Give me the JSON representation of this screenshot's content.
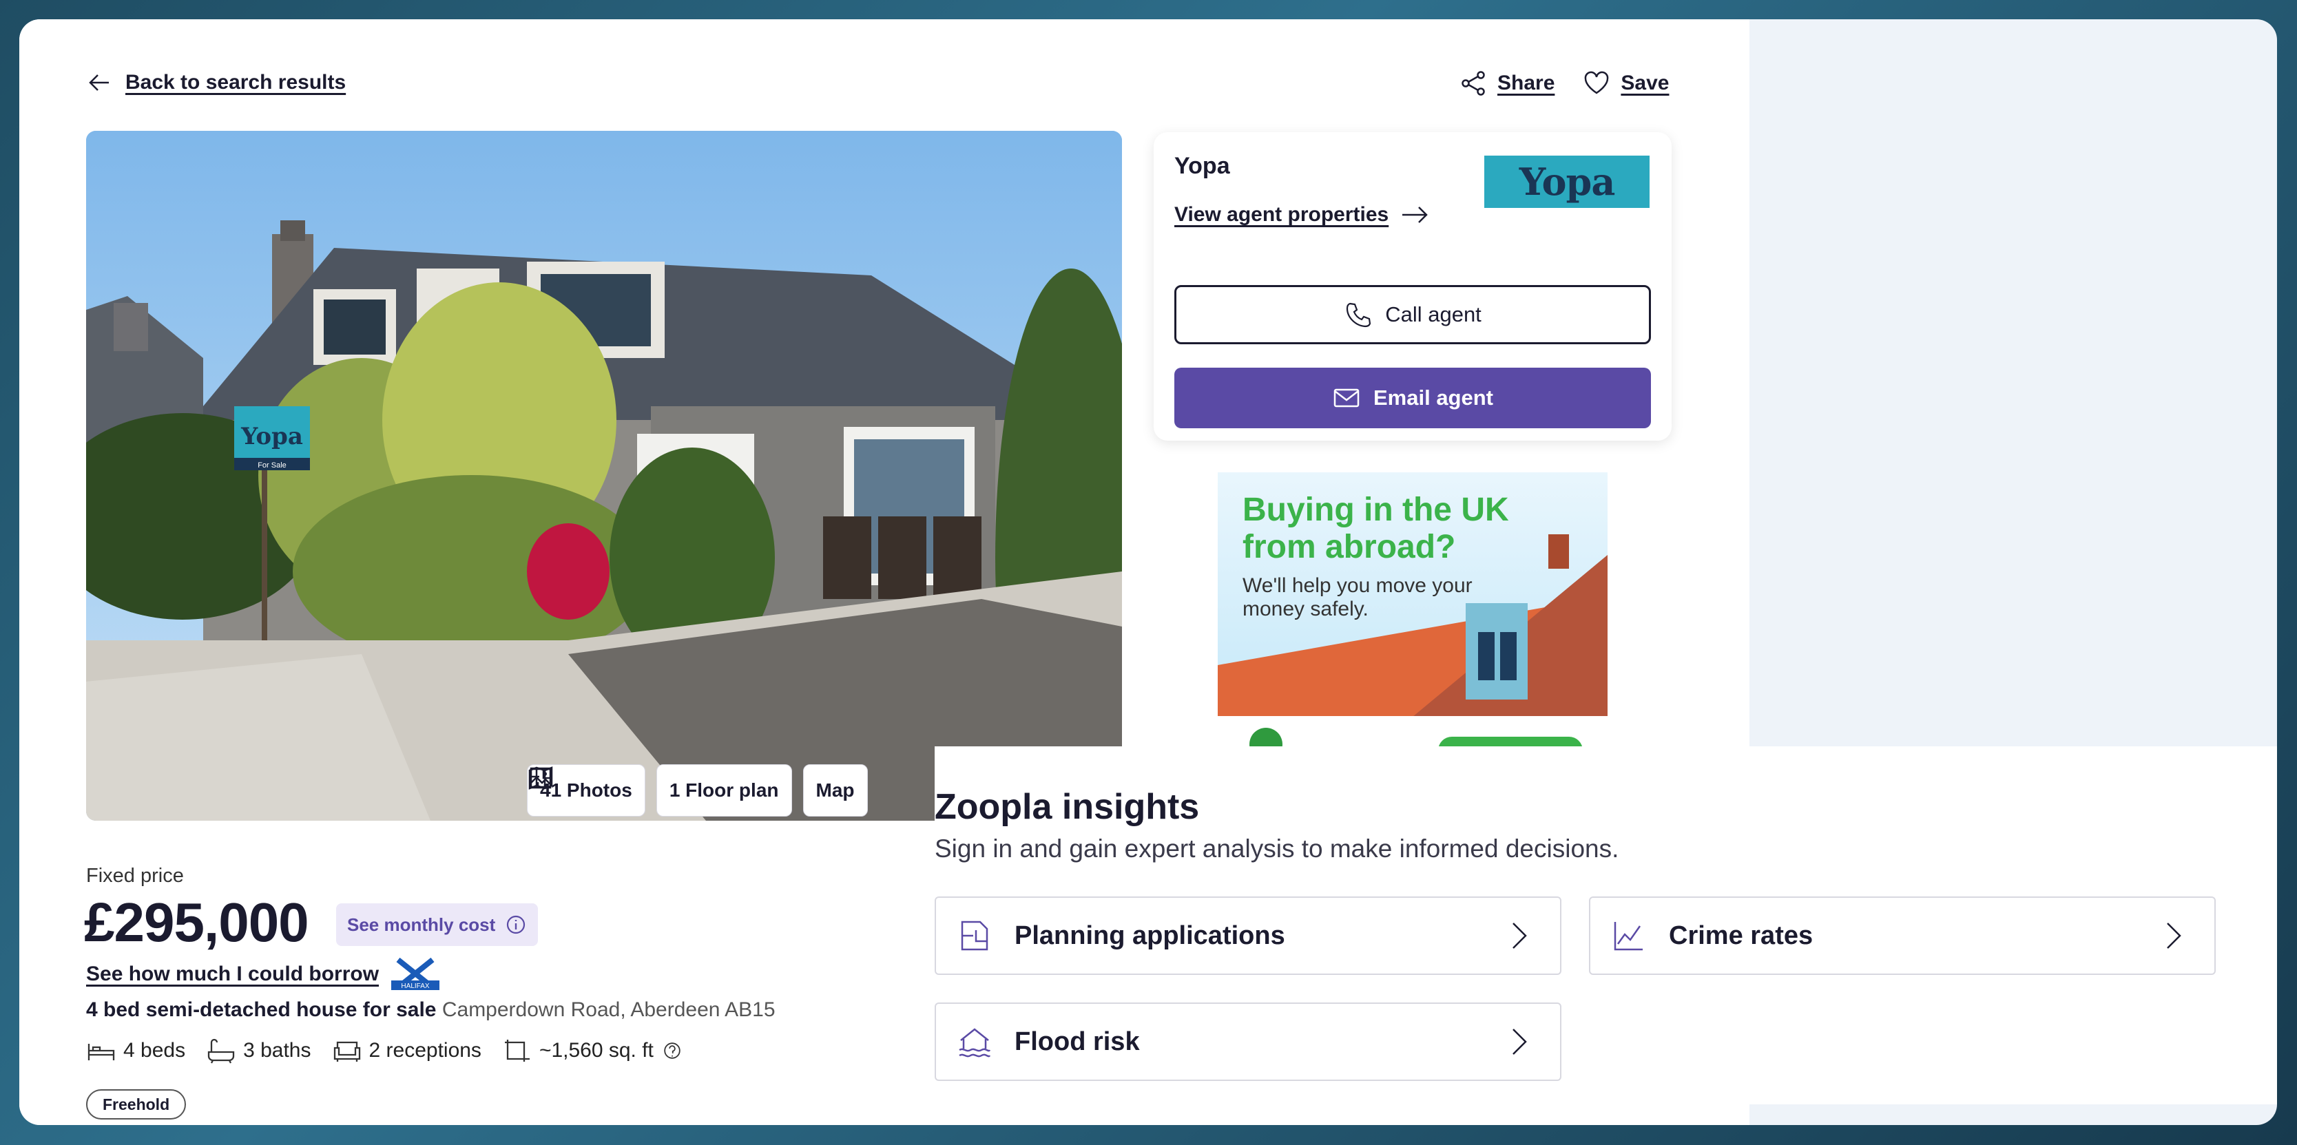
{
  "nav": {
    "back_label": "Back to search results",
    "share_label": "Share",
    "save_label": "Save"
  },
  "gallery": {
    "photos_label": "41 Photos",
    "floorplan_label": "1 Floor plan",
    "map_label": "Map",
    "sign_brand": "Yopa",
    "sign_text": "For Sale"
  },
  "agent": {
    "name": "Yopa",
    "logo_text": "Yopa",
    "view_properties_label": "View agent properties",
    "call_label": "Call agent",
    "email_label": "Email agent"
  },
  "ad": {
    "headline": "Buying in the UK from abroad?",
    "subtext": "We'll help you move your money safely."
  },
  "listing": {
    "price_type": "Fixed price",
    "price": "£295,000",
    "monthly_cost_label": "See monthly cost",
    "borrow_label": "See how much I could borrow",
    "lender_logo": "HALIFAX",
    "title": "4 bed semi-detached house for sale",
    "address": "Camperdown Road, Aberdeen AB15",
    "features": {
      "beds": "4 beds",
      "baths": "3 baths",
      "receptions": "2 receptions",
      "area": "~1,560 sq. ft"
    },
    "tenure": "Freehold"
  },
  "insights": {
    "title": "Zoopla insights",
    "subtitle": "Sign in and gain expert analysis to make informed decisions.",
    "cards": [
      {
        "label": "Planning applications",
        "icon": "planning-icon"
      },
      {
        "label": "Crime rates",
        "icon": "crime-chart-icon"
      },
      {
        "label": "Flood risk",
        "icon": "flood-icon"
      }
    ]
  },
  "colors": {
    "accent": "#5a4aa5",
    "text": "#1b1b2f",
    "yopa_teal": "#2ba9bf",
    "ad_green": "#3bb34a"
  }
}
